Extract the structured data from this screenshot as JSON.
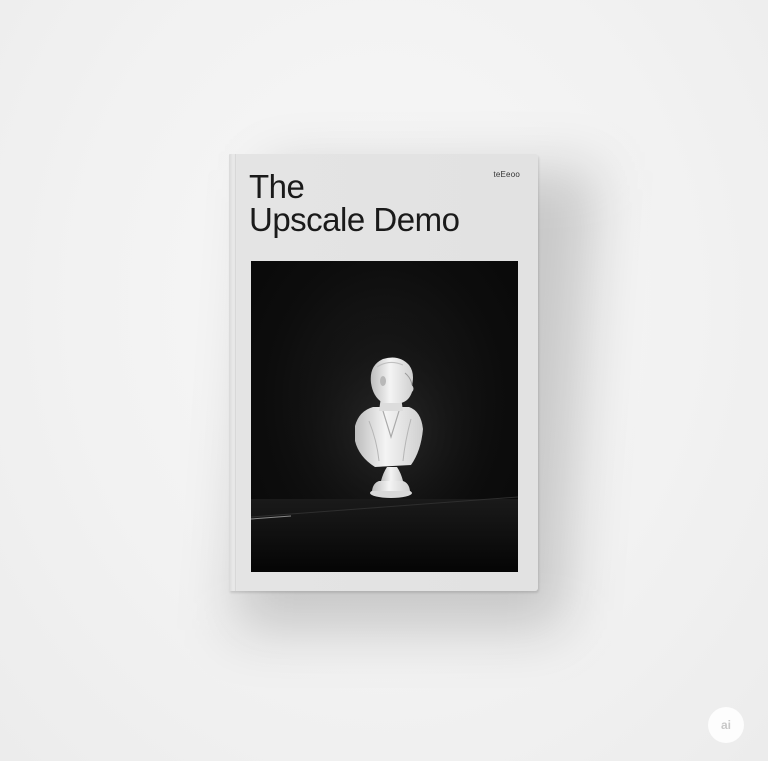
{
  "book": {
    "title_line1": "The",
    "title_line2": "Upscale Demo",
    "publisher_mark": "teEeoo"
  },
  "cover_image": {
    "subject": "white-bust-sculpture"
  },
  "badge": {
    "label": "ai"
  },
  "colors": {
    "background": "#f1f1f1",
    "cover": "#e2e2e2",
    "title_text": "#1a1a1a",
    "photo_background": "#0d0d0d"
  }
}
